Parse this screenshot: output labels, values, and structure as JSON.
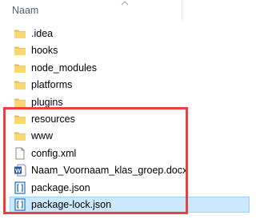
{
  "header": {
    "column_name": "Naam"
  },
  "files": [
    {
      "name": ".idea",
      "type": "folder"
    },
    {
      "name": "hooks",
      "type": "folder"
    },
    {
      "name": "node_modules",
      "type": "folder"
    },
    {
      "name": "platforms",
      "type": "folder"
    },
    {
      "name": "plugins",
      "type": "folder"
    },
    {
      "name": "resources",
      "type": "folder"
    },
    {
      "name": "www",
      "type": "folder"
    },
    {
      "name": "config.xml",
      "type": "xml-file"
    },
    {
      "name": "Naam_Voornaam_klas_groep.docx",
      "type": "word-document"
    },
    {
      "name": "package.json",
      "type": "json-file"
    },
    {
      "name": "package-lock.json",
      "type": "json-file",
      "selected": true
    }
  ],
  "colors": {
    "folder": "#f8d775",
    "highlight_border": "#e8413e",
    "selection_background": "#cce8ff",
    "word_blue": "#2b579a",
    "json_blue": "#1e6fc4"
  }
}
